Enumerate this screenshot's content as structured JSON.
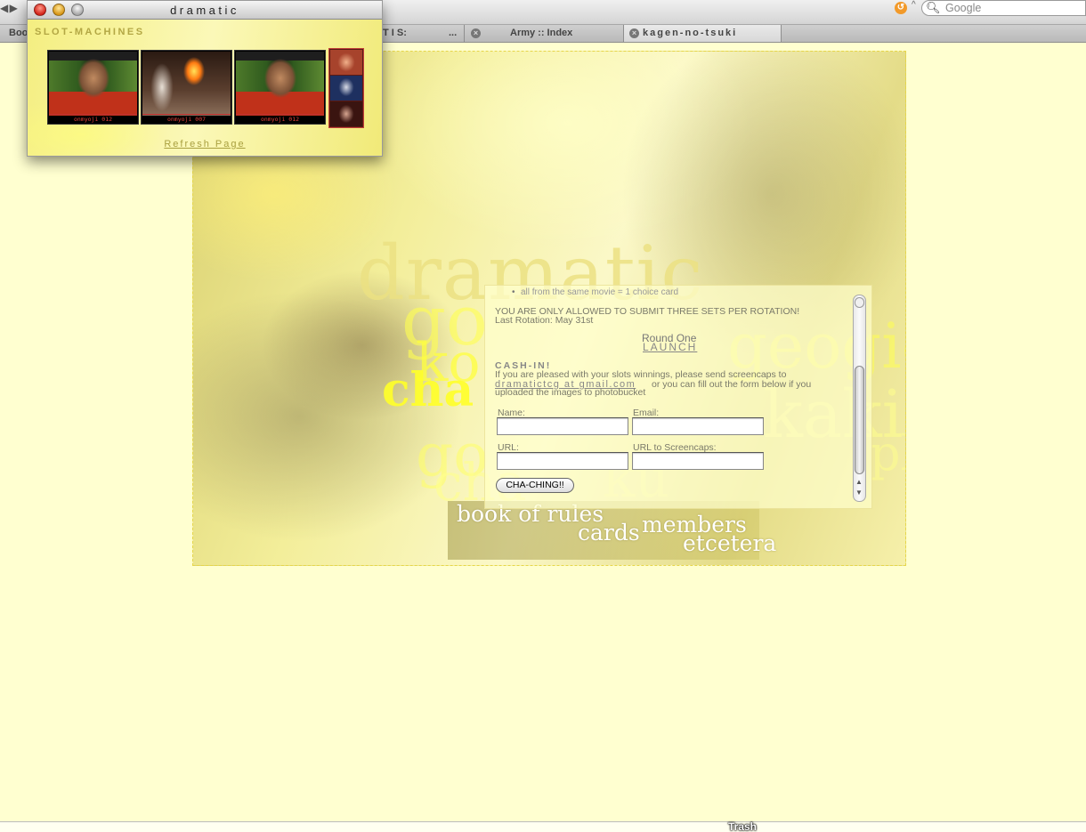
{
  "browser": {
    "search_placeholder": "Google",
    "tabs": [
      {
        "label": "Boo",
        "active": false
      },
      {
        "label": "T I S:",
        "active": false
      },
      {
        "label": "...",
        "active": false
      },
      {
        "label": "Army :: Index",
        "active": false
      },
      {
        "label": "kagen-no-tsuki",
        "active": true
      }
    ]
  },
  "popup": {
    "title": "dramatic",
    "heading": "SLOT-MACHINES",
    "slots": [
      {
        "label": "onmyoji 012"
      },
      {
        "label": "onmyoji 007"
      },
      {
        "label": "onmyoji 012"
      }
    ],
    "refresh_label": "Refresh Page"
  },
  "site": {
    "logo_text": "dramatic",
    "bg_words": [
      "go",
      "ko",
      "cha",
      "go",
      "cha",
      "ku",
      "geogie",
      "kaki",
      "pl"
    ],
    "nav": {
      "rules": "book of rules",
      "cards": "cards",
      "members": "members",
      "etcetera": "etcetera"
    }
  },
  "content": {
    "peek_text": "all from the same movie = 1 choice card",
    "warning": "YOU ARE ONLY ALLOWED TO SUBMIT THREE SETS PER ROTATION!",
    "last_rotation": "Last Rotation: May 31st",
    "round_label": "Round One",
    "launch_label": "LAUNCH",
    "cashin_title": "CASH-IN!",
    "cashin_text1": "If you are pleased with your slots winnings, please send screencaps to",
    "cashin_email": "dramatictcg at gmail.com",
    "cashin_text2": "or you can fill out the form below if you",
    "cashin_text3": "uploaded the images to photobucket",
    "form": {
      "name_label": "Name:",
      "email_label": "Email:",
      "url_label": "URL:",
      "screencaps_label": "URL to Screencaps:",
      "submit_label": "CHA-CHING!!"
    }
  },
  "dock": {
    "trash_label": "Trash"
  }
}
